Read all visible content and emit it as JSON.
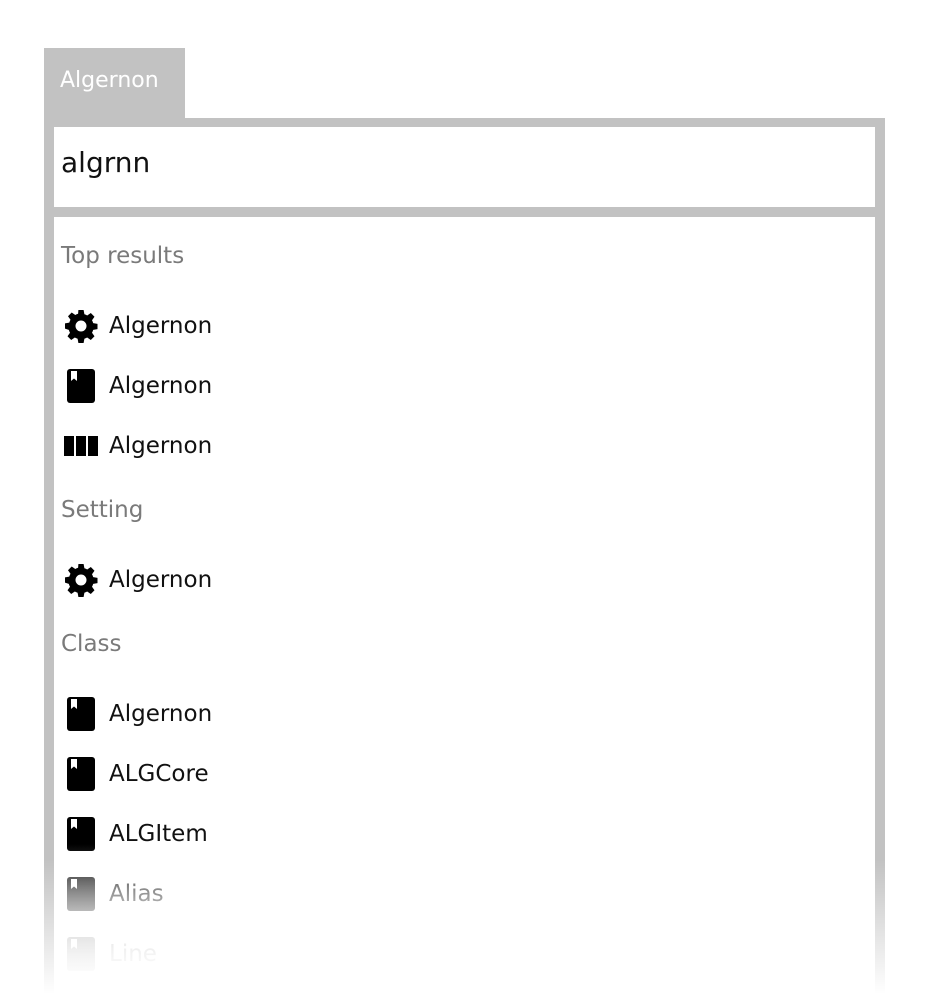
{
  "tab": {
    "label": "Algernon"
  },
  "search": {
    "value": "algrnn"
  },
  "sections": {
    "top_results": {
      "header": "Top results",
      "items": [
        {
          "icon": "gear-icon",
          "label": "Algernon"
        },
        {
          "icon": "book-icon",
          "label": "Algernon"
        },
        {
          "icon": "library-icon",
          "label": "Algernon"
        }
      ]
    },
    "setting": {
      "header": "Setting",
      "items": [
        {
          "icon": "gear-icon",
          "label": "Algernon"
        }
      ]
    },
    "class": {
      "header": "Class",
      "items": [
        {
          "icon": "book-icon",
          "label": "Algernon"
        },
        {
          "icon": "book-icon",
          "label": "ALGCore"
        },
        {
          "icon": "book-icon",
          "label": "ALGItem"
        },
        {
          "icon": "book-icon",
          "label": "Alias"
        },
        {
          "icon": "book-icon",
          "label": "Line"
        }
      ]
    }
  },
  "colors": {
    "frame": "#c2c2c2",
    "section_header": "#7a7a7a",
    "item_text": "#111111"
  }
}
